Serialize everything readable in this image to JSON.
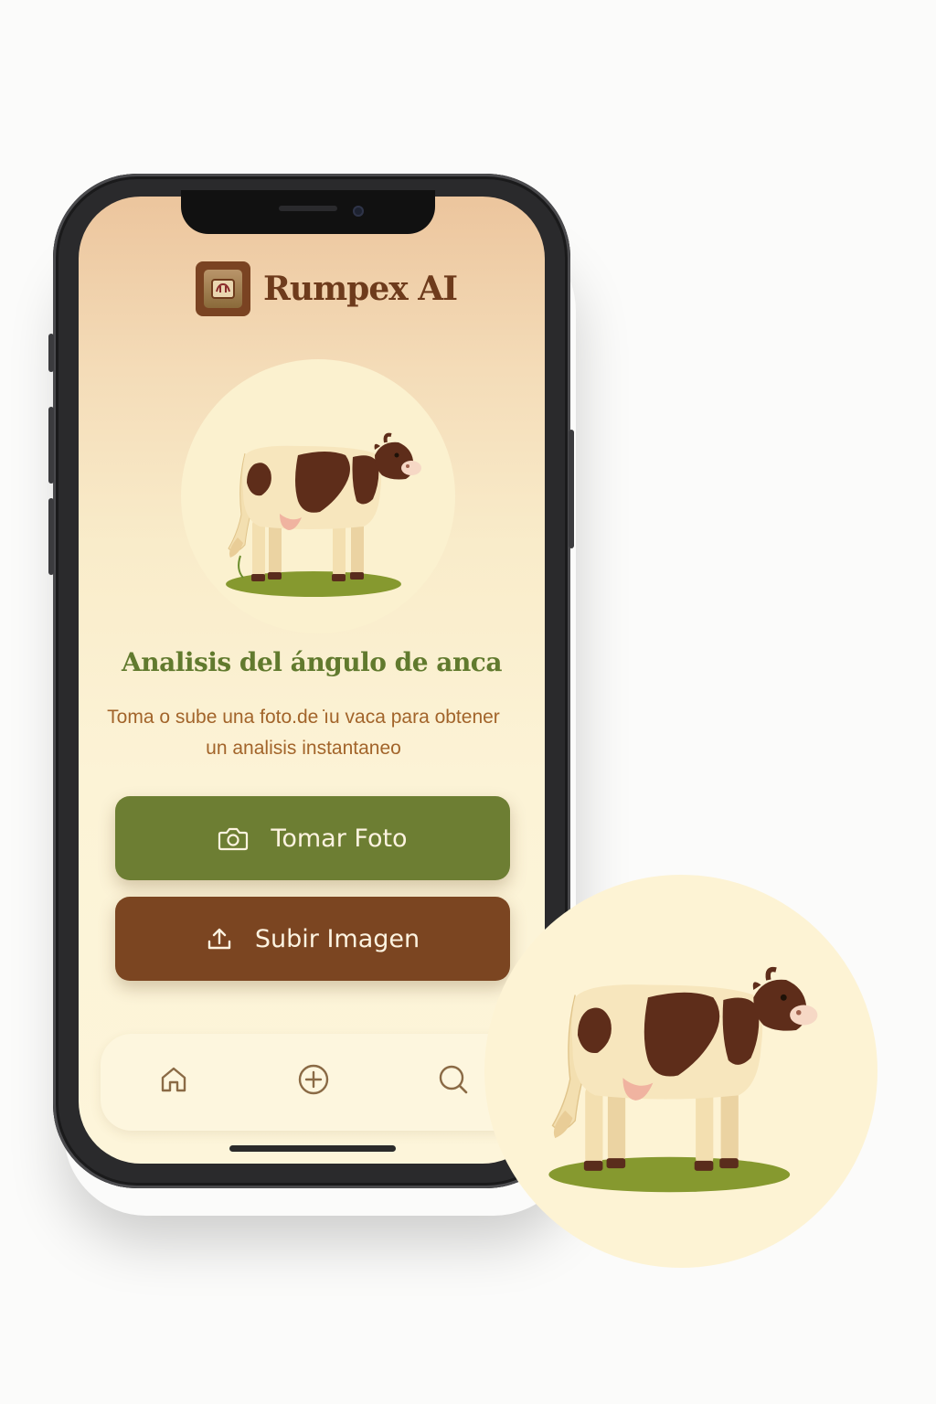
{
  "app": {
    "title": "Rumpex AI"
  },
  "hero": {
    "illustration": "cow-illustration"
  },
  "main": {
    "headline": "Analisis del ángulo de anca",
    "subtitle": "Toma o sube una foto.de ̇ıu vaca para obtener un analisis instantaneo"
  },
  "actions": {
    "take_photo_label": "Tomar Foto",
    "take_photo_icon": "camera-icon",
    "upload_label": "Subir Imagen",
    "upload_icon": "upload-icon"
  },
  "nav": {
    "items": [
      {
        "icon": "home-icon"
      },
      {
        "icon": "add-circle-icon"
      },
      {
        "icon": "search-icon"
      }
    ]
  },
  "colors": {
    "brand_brown": "#7b4521",
    "brand_green": "#6d7e33",
    "headline_green": "#617a2e",
    "subtitle_brown": "#a2642a",
    "title_brown": "#6e3b1c",
    "background_cream": "#fdf5da"
  }
}
